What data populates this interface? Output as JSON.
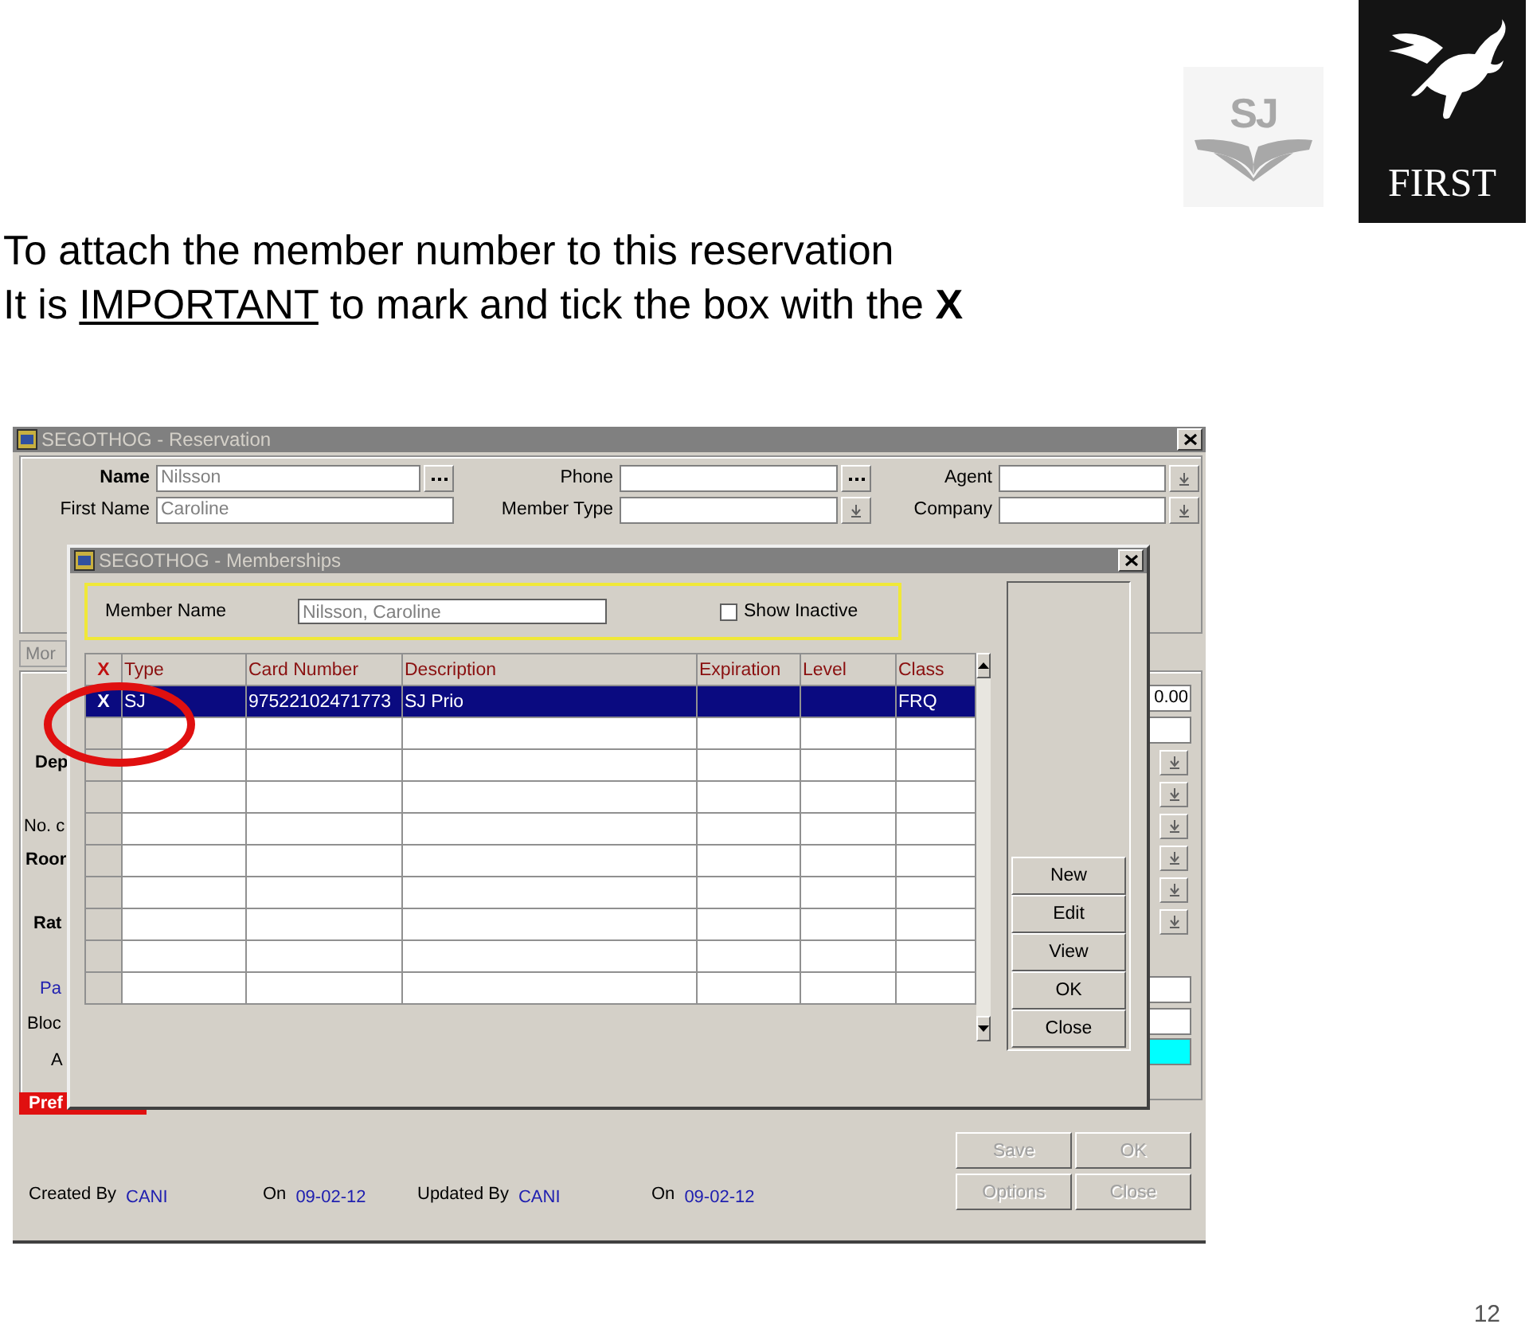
{
  "slide": {
    "title_lines": [
      [
        {
          "kind": "plain",
          "text": "To attach the member number to this reservation"
        }
      ],
      [
        {
          "kind": "plain",
          "text": "It is "
        },
        {
          "kind": "underlined",
          "text": "IMPORTANT"
        },
        {
          "kind": "plain",
          "text": " to mark and tick the box with the "
        },
        {
          "kind": "bold",
          "text": "X"
        }
      ]
    ],
    "logos": [
      {
        "kind": "sj",
        "text": "SJ"
      },
      {
        "kind": "first",
        "text": "FIRST"
      }
    ],
    "page_number": "12"
  },
  "reservation_window": {
    "title": "SEGOTHOG - Reservation",
    "field_columns": [
      [
        {
          "label": "Name",
          "bold": true,
          "value": "Nilsson",
          "kind": "ellipsis"
        },
        {
          "label": "First Name",
          "bold": false,
          "value": "Caroline",
          "kind": "plain"
        }
      ],
      [
        {
          "label": "Phone",
          "bold": false,
          "kind": "ellipsis"
        },
        {
          "label": "Member Type",
          "bold": false,
          "kind": "dropdown"
        }
      ],
      [
        {
          "label": "Agent",
          "bold": false,
          "kind": "dropdown"
        },
        {
          "label": "Company",
          "bold": false,
          "kind": "dropdown"
        }
      ]
    ],
    "tab": "Mor",
    "side_labels": [
      {
        "text": "Dep",
        "kind": "bold"
      },
      {
        "text": "No. c",
        "kind": "plain"
      },
      {
        "text": "Roor",
        "kind": "bold"
      },
      {
        "text": "Rat",
        "kind": "bold"
      },
      {
        "text": "Pa",
        "kind": "link"
      },
      {
        "text": "Bloc",
        "kind": "plain"
      },
      {
        "text": "A",
        "kind": "plain"
      }
    ],
    "side_fields": [
      {
        "kind": "field",
        "value": "0.00"
      },
      {
        "kind": "field"
      },
      {
        "kind": "dropdown"
      },
      {
        "kind": "dropdown"
      },
      {
        "kind": "dropdown"
      },
      {
        "kind": "dropdown"
      },
      {
        "kind": "dropdown"
      },
      {
        "kind": "dropdown"
      },
      {
        "kind": "field"
      },
      {
        "kind": "field"
      },
      {
        "kind": "highlighted"
      }
    ],
    "flag": "Pref",
    "buttons": [
      {
        "label": "Save",
        "disabled": true
      },
      {
        "label": "OK",
        "disabled": true
      },
      {
        "label": "Options",
        "disabled": true
      },
      {
        "label": "Close",
        "disabled": true
      }
    ],
    "audit": [
      {
        "label": "Created By",
        "value": "CANI"
      },
      {
        "label": "On",
        "value": "09-02-12"
      },
      {
        "label": "Updated By",
        "value": "CANI"
      },
      {
        "label": "On",
        "value": "09-02-12"
      }
    ]
  },
  "memberships_dialog": {
    "title": "SEGOTHOG - Memberships",
    "member_name": {
      "label": "Member Name",
      "value": "Nilsson, Caroline"
    },
    "show_inactive": {
      "label": "Show Inactive",
      "checked": false
    },
    "table": {
      "marker_header": "X",
      "columns": [
        "Type",
        "Card Number",
        "Description",
        "Expiration",
        "Level",
        "Class"
      ],
      "rows": [
        {
          "selected": true,
          "marker": "X",
          "cells": [
            "SJ",
            "97522102471773",
            "SJ Prio",
            "",
            "",
            "FRQ"
          ]
        }
      ]
    },
    "buttons": [
      {
        "label": "New"
      },
      {
        "label": "Edit"
      },
      {
        "label": "View"
      },
      {
        "label": "OK"
      },
      {
        "label": "Close"
      }
    ]
  }
}
